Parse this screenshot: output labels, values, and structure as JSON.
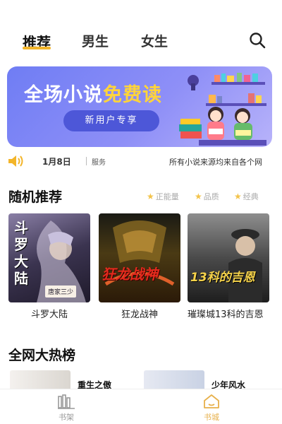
{
  "tabs": [
    {
      "label": "推荐",
      "active": true
    },
    {
      "label": "男生",
      "active": false
    },
    {
      "label": "女生",
      "active": false
    }
  ],
  "banner": {
    "title_prefix": "全场小说",
    "title_highlight": "免费读",
    "button_label": "新用户专享"
  },
  "notice": {
    "date": "1月8日",
    "tag": "服务",
    "text": "所有小说来源均来自各个网"
  },
  "random_section": {
    "title": "随机推荐",
    "filters": [
      "正能量",
      "品质",
      "经典"
    ]
  },
  "books": [
    {
      "title": "斗罗大陆",
      "cover_text": "斗罗大陆",
      "cover_badge": "唐家三少"
    },
    {
      "title": "狂龙战神",
      "cover_text": "狂龙战神"
    },
    {
      "title": "璀璨城13科的吉恩",
      "cover_text": "13科的吉恩"
    }
  ],
  "hot_section": {
    "title": "全网大热榜",
    "items": [
      {
        "title": "重生之傲"
      },
      {
        "title": "少年风水"
      }
    ]
  },
  "bottom_nav": {
    "items": [
      {
        "label": "书架",
        "active": false
      },
      {
        "label": "书城",
        "active": true
      }
    ]
  },
  "colors": {
    "accent": "#f3b52a",
    "banner_start": "#6f7df4",
    "banner_highlight": "#ffd43b",
    "nav_active": "#e7b04b",
    "nav_inactive": "#999999"
  }
}
